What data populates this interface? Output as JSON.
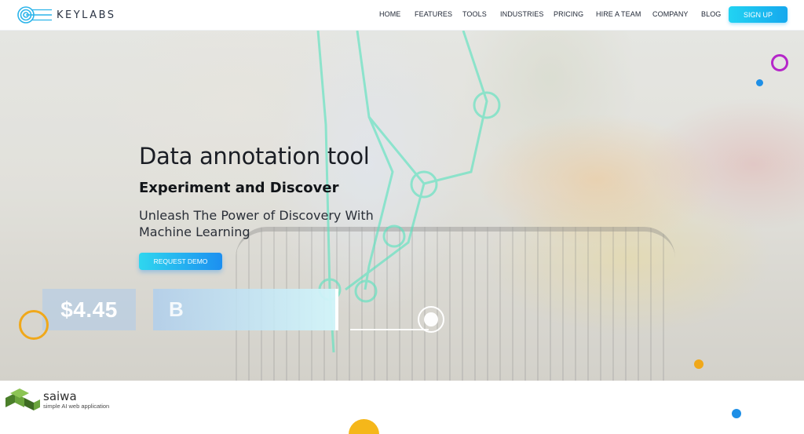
{
  "header": {
    "logo_text": "KEYLABS",
    "nav": [
      {
        "label": "HOME"
      },
      {
        "label": "FEATURES"
      },
      {
        "label": "TOOLS"
      },
      {
        "label": "INDUSTRIES"
      },
      {
        "label": "PRICING"
      },
      {
        "label": "HIRE A TEAM"
      },
      {
        "label": "COMPANY"
      },
      {
        "label": "BLOG"
      }
    ],
    "signup_label": "SIGN UP",
    "accent_color": "#1ea8ee"
  },
  "hero": {
    "title": "Data annotation tool",
    "subtitle": "Experiment and Discover",
    "tagline": "Unleash The Power of Discovery With Machine Learning",
    "cta_label": "REQUEST DEMO",
    "price_tag": "$4.45",
    "label_box_text": "B"
  },
  "watermark": {
    "name": "saiwa",
    "tagline": "simple AI web application"
  },
  "colors": {
    "annotation_line": "#5fe3c0",
    "ring_purple": "#b526c9",
    "ring_orange": "#f0a81a",
    "dot_blue": "#1e8fe6",
    "dot_orange": "#f0a81a",
    "brand_green": "#6aa43c"
  },
  "icons": [
    "keylabs-logo-icon",
    "saiwa-logo-icon"
  ]
}
